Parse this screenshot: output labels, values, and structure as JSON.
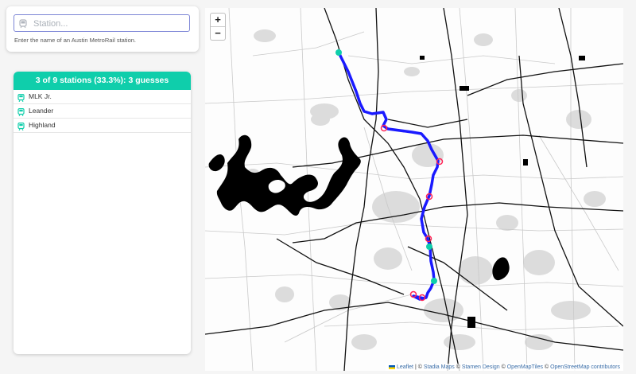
{
  "search": {
    "placeholder": "Station...",
    "help": "Enter the name of an Austin MetroRail station.",
    "icon": "train-icon"
  },
  "results": {
    "header": "3 of 9 stations (33.3%): 3 guesses",
    "header_color": "#0fceab",
    "items": [
      {
        "label": "MLK Jr.",
        "icon": "train-icon"
      },
      {
        "label": "Leander",
        "icon": "train-icon"
      },
      {
        "label": "Highland",
        "icon": "train-icon"
      }
    ]
  },
  "map": {
    "zoom_in": "+",
    "zoom_out": "−",
    "attribution": {
      "leaflet": "Leaflet",
      "sep1": " | © ",
      "stadia": "Stadia Maps",
      "sep2": " © ",
      "stamen": "Stamen Design",
      "sep3": " © ",
      "omt": "OpenMapTiles",
      "sep4": " © ",
      "osm": "OpenStreetMap contributors"
    },
    "line_color": "#1a1aff",
    "found_station_color": "#0fceab",
    "unfound_station_color": "#ff2255"
  }
}
